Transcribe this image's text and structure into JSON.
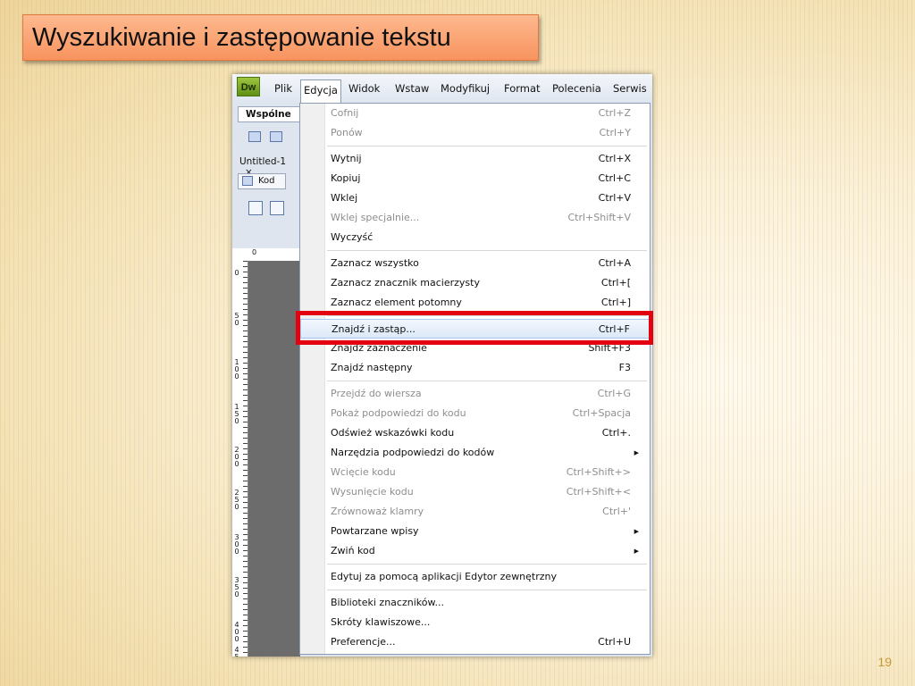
{
  "slide": {
    "title": "Wyszukiwanie i zastępowanie tekstu",
    "page_number": "19"
  },
  "app": {
    "logo_text": "Dw",
    "menubar": [
      "Plik",
      "Edycja",
      "Widok",
      "Wstaw",
      "Modyfikuj",
      "Format",
      "Polecenia",
      "Serwis"
    ],
    "active_menu": "Edycja",
    "left_panel": {
      "insert_tab": "Wspólne",
      "document_tab": "Untitled-1",
      "document_tab_close": "×",
      "code_button": "Kod",
      "ruler_top_zero": "0",
      "ruler_left_marks": [
        "0",
        "50",
        "100",
        "150",
        "200",
        "250",
        "300",
        "350",
        "400",
        "45"
      ]
    },
    "edit_menu": {
      "groups": [
        [
          {
            "label": "Cofnij",
            "shortcut": "Ctrl+Z",
            "enabled": false
          },
          {
            "label": "Ponów",
            "shortcut": "Ctrl+Y",
            "enabled": false
          }
        ],
        [
          {
            "label": "Wytnij",
            "shortcut": "Ctrl+X",
            "enabled": true
          },
          {
            "label": "Kopiuj",
            "shortcut": "Ctrl+C",
            "enabled": true
          },
          {
            "label": "Wklej",
            "shortcut": "Ctrl+V",
            "enabled": true
          },
          {
            "label": "Wklej specjalnie...",
            "shortcut": "Ctrl+Shift+V",
            "enabled": false
          },
          {
            "label": "Wyczyść",
            "shortcut": "",
            "enabled": true
          }
        ],
        [
          {
            "label": "Zaznacz wszystko",
            "shortcut": "Ctrl+A",
            "enabled": true
          },
          {
            "label": "Zaznacz znacznik macierzysty",
            "shortcut": "Ctrl+[",
            "enabled": true
          },
          {
            "label": "Zaznacz element potomny",
            "shortcut": "Ctrl+]",
            "enabled": true
          }
        ],
        [
          {
            "label": "Znajdź i zastąp...",
            "shortcut": "Ctrl+F",
            "enabled": true,
            "highlighted": true
          },
          {
            "label": "Znajdź zaznaczenie",
            "shortcut": "Shift+F3",
            "enabled": true
          },
          {
            "label": "Znajdź następny",
            "shortcut": "F3",
            "enabled": true
          }
        ],
        [
          {
            "label": "Przejdź do wiersza",
            "shortcut": "Ctrl+G",
            "enabled": false
          },
          {
            "label": "Pokaż podpowiedzi do kodu",
            "shortcut": "Ctrl+Spacja",
            "enabled": false
          },
          {
            "label": "Odśwież wskazówki kodu",
            "shortcut": "Ctrl+.",
            "enabled": true
          },
          {
            "label": "Narzędzia podpowiedzi do kodów",
            "shortcut": "",
            "enabled": true,
            "submenu": true
          },
          {
            "label": "Wcięcie kodu",
            "shortcut": "Ctrl+Shift+>",
            "enabled": false
          },
          {
            "label": "Wysunięcie kodu",
            "shortcut": "Ctrl+Shift+<",
            "enabled": false
          },
          {
            "label": "Zrównoważ klamry",
            "shortcut": "Ctrl+'",
            "enabled": false
          },
          {
            "label": "Powtarzane wpisy",
            "shortcut": "",
            "enabled": true,
            "submenu": true
          },
          {
            "label": "Zwiń kod",
            "shortcut": "",
            "enabled": true,
            "submenu": true
          }
        ],
        [
          {
            "label": "Edytuj za pomocą aplikacji Edytor zewnętrzny",
            "shortcut": "",
            "enabled": true
          }
        ],
        [
          {
            "label": "Biblioteki znaczników...",
            "shortcut": "",
            "enabled": true
          },
          {
            "label": "Skróty klawiszowe...",
            "shortcut": "",
            "enabled": true
          },
          {
            "label": "Preferencje...",
            "shortcut": "Ctrl+U",
            "enabled": true
          }
        ]
      ]
    }
  },
  "colors": {
    "highlight_frame": "#e3000f",
    "title_box": "#f8935f",
    "disabled_text": "#8e8e8e"
  }
}
